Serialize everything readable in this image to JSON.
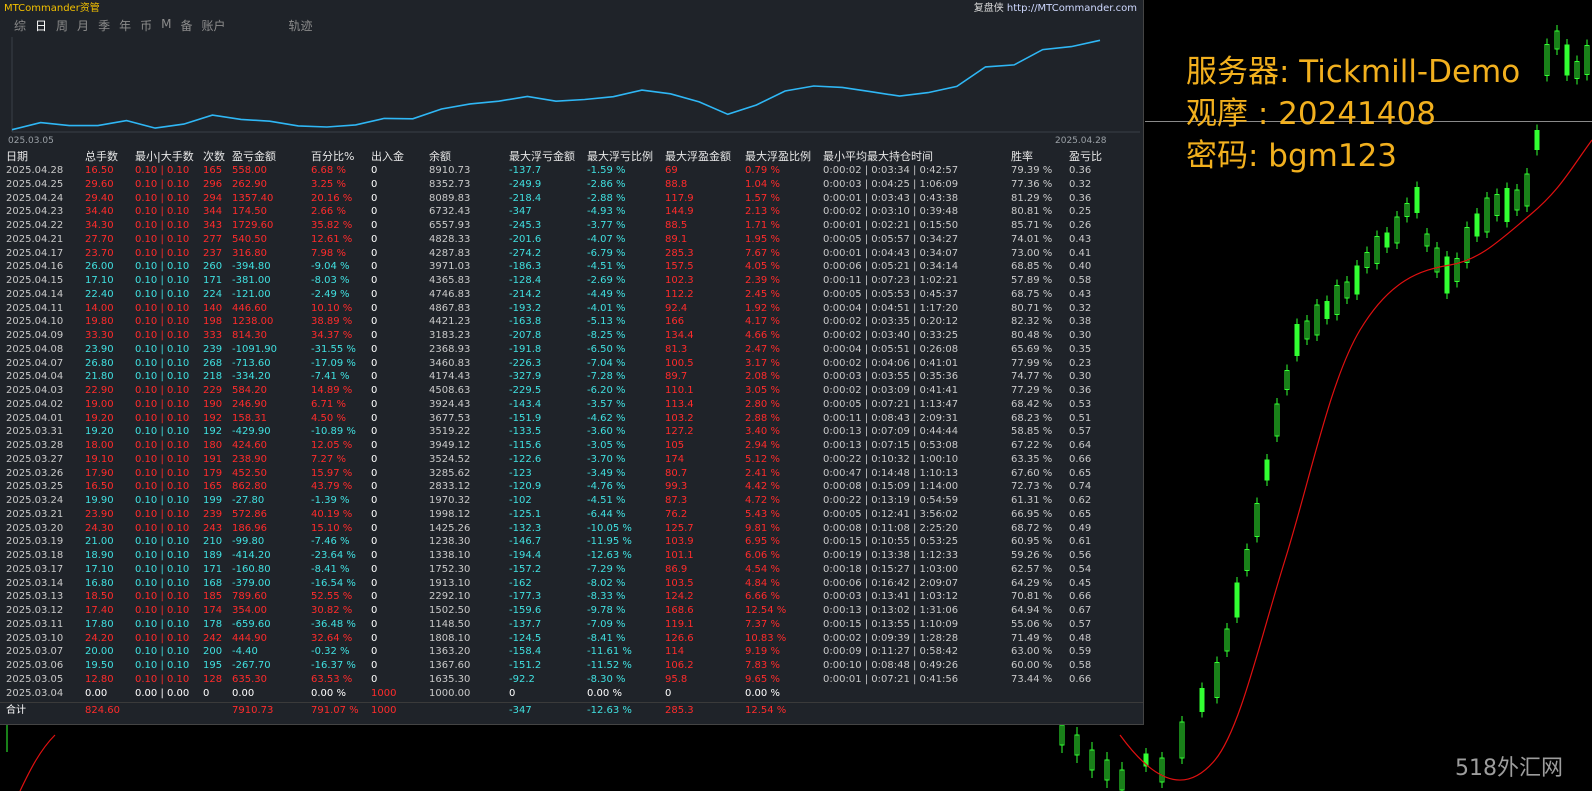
{
  "window": {
    "app_title": "MTCommander资管",
    "replay_label": "复盘侠",
    "replay_url": "http://MTCommander.com"
  },
  "tabs": [
    {
      "label": "综",
      "active": false
    },
    {
      "label": "日",
      "active": true
    },
    {
      "label": "周",
      "active": false
    },
    {
      "label": "月",
      "active": false
    },
    {
      "label": "季",
      "active": false
    },
    {
      "label": "年",
      "active": false
    },
    {
      "label": "币",
      "active": false
    },
    {
      "label": "M",
      "active": false
    },
    {
      "label": "备",
      "active": false
    },
    {
      "label": "账户",
      "active": false
    },
    {
      "label": "轨迹",
      "active": false
    }
  ],
  "equity_chart": {
    "start_label": "025.03.05",
    "end_label": "2025.04.28",
    "color": "#2fb7f5",
    "values": [
      1000,
      1635.3,
      1367.6,
      1363.2,
      1808.1,
      1148.5,
      1502.5,
      2292.1,
      1913.1,
      1752.3,
      1338.1,
      1238.3,
      1425.26,
      1998.12,
      1970.32,
      2833.12,
      3285.62,
      3524.52,
      3949.12,
      3519.22,
      3677.53,
      3924.43,
      4508.63,
      4174.43,
      3460.83,
      2368.93,
      3183.23,
      4421.23,
      4867.83,
      4746.83,
      4365.83,
      3971.03,
      4287.83,
      4828.33,
      6557.93,
      6732.43,
      8089.63,
      8352.73,
      8910.73
    ]
  },
  "table": {
    "headers": [
      "日期",
      "总手数",
      "最小|大手数",
      "次数",
      "盈亏金额",
      "百分比%",
      "出入金",
      "余额",
      "最大浮亏金额",
      "最大浮亏比例",
      "最大浮盈金额",
      "最大浮盈比例",
      "最小平均最大持仓时间",
      "胜率",
      "盈亏比"
    ],
    "rows": [
      [
        "2025.04.28",
        "16.50",
        "0.10 | 0.10",
        "165",
        "558.00",
        "6.68 %",
        "0",
        "8910.73",
        "-137.7",
        "-1.59 %",
        "69",
        "0.79 %",
        "0:00:02 | 0:03:34 | 0:42:57",
        "79.39 %",
        "0.36"
      ],
      [
        "2025.04.25",
        "29.60",
        "0.10 | 0.10",
        "296",
        "262.90",
        "3.25 %",
        "0",
        "8352.73",
        "-249.9",
        "-2.86 %",
        "88.8",
        "1.04 %",
        "0:00:03 | 0:04:25 | 1:06:09",
        "77.36 %",
        "0.32"
      ],
      [
        "2025.04.24",
        "29.40",
        "0.10 | 0.10",
        "294",
        "1357.40",
        "20.16 %",
        "0",
        "8089.83",
        "-218.4",
        "-2.88 %",
        "117.9",
        "1.57 %",
        "0:00:01 | 0:03:43 | 0:43:38",
        "81.29 %",
        "0.36"
      ],
      [
        "2025.04.23",
        "34.40",
        "0.10 | 0.10",
        "344",
        "174.50",
        "2.66 %",
        "0",
        "6732.43",
        "-347",
        "-4.93 %",
        "144.9",
        "2.13 %",
        "0:00:02 | 0:03:10 | 0:39:48",
        "80.81 %",
        "0.25"
      ],
      [
        "2025.04.22",
        "34.30",
        "0.10 | 0.10",
        "343",
        "1729.60",
        "35.82 %",
        "0",
        "6557.93",
        "-245.3",
        "-3.77 %",
        "88.5",
        "1.71 %",
        "0:00:01 | 0:02:21 | 0:15:50",
        "85.71 %",
        "0.26"
      ],
      [
        "2025.04.21",
        "27.70",
        "0.10 | 0.10",
        "277",
        "540.50",
        "12.61 %",
        "0",
        "4828.33",
        "-201.6",
        "-4.07 %",
        "89.1",
        "1.95 %",
        "0:00:05 | 0:05:57 | 0:34:27",
        "74.01 %",
        "0.43"
      ],
      [
        "2025.04.17",
        "23.70",
        "0.10 | 0.10",
        "237",
        "316.80",
        "7.98 %",
        "0",
        "4287.83",
        "-274.2",
        "-6.79 %",
        "285.3",
        "7.67 %",
        "0:00:01 | 0:04:43 | 0:34:07",
        "73.00 %",
        "0.41"
      ],
      [
        "2025.04.16",
        "26.00",
        "0.10 | 0.10",
        "260",
        "-394.80",
        "-9.04 %",
        "0",
        "3971.03",
        "-186.3",
        "-4.51 %",
        "157.5",
        "4.05 %",
        "0:00:06 | 0:05:21 | 0:34:14",
        "68.85 %",
        "0.40"
      ],
      [
        "2025.04.15",
        "17.10",
        "0.10 | 0.10",
        "171",
        "-381.00",
        "-8.03 %",
        "0",
        "4365.83",
        "-128.4",
        "-2.69 %",
        "102.3",
        "2.39 %",
        "0:00:11 | 0:07:23 | 1:02:21",
        "57.89 %",
        "0.58"
      ],
      [
        "2025.04.14",
        "22.40",
        "0.10 | 0.10",
        "224",
        "-121.00",
        "-2.49 %",
        "0",
        "4746.83",
        "-214.2",
        "-4.49 %",
        "112.2",
        "2.45 %",
        "0:00:05 | 0:05:53 | 0:45:37",
        "68.75 %",
        "0.43"
      ],
      [
        "2025.04.11",
        "14.00",
        "0.10 | 0.10",
        "140",
        "446.60",
        "10.10 %",
        "0",
        "4867.83",
        "-193.2",
        "-4.01 %",
        "92.4",
        "1.92 %",
        "0:00:04 | 0:04:51 | 1:17:20",
        "80.71 %",
        "0.32"
      ],
      [
        "2025.04.10",
        "19.80",
        "0.10 | 0.10",
        "198",
        "1238.00",
        "38.89 %",
        "0",
        "4421.23",
        "-163.8",
        "-5.13 %",
        "166",
        "4.17 %",
        "0:00:02 | 0:03:35 | 0:20:12",
        "82.32 %",
        "0.38"
      ],
      [
        "2025.04.09",
        "33.30",
        "0.10 | 0.10",
        "333",
        "814.30",
        "34.37 %",
        "0",
        "3183.23",
        "-207.8",
        "-8.25 %",
        "134.4",
        "4.66 %",
        "0:00:02 | 0:03:40 | 0:33:25",
        "80.48 %",
        "0.30"
      ],
      [
        "2025.04.08",
        "23.90",
        "0.10 | 0.10",
        "239",
        "-1091.90",
        "-31.55 %",
        "0",
        "2368.93",
        "-191.8",
        "-6.50 %",
        "81.3",
        "2.47 %",
        "0:00:04 | 0:05:51 | 0:26:08",
        "65.69 %",
        "0.35"
      ],
      [
        "2025.04.07",
        "26.80",
        "0.10 | 0.10",
        "268",
        "-713.60",
        "-17.09 %",
        "0",
        "3460.83",
        "-226.3",
        "-7.04 %",
        "100.5",
        "3.17 %",
        "0:00:02 | 0:04:06 | 0:41:01",
        "77.99 %",
        "0.23"
      ],
      [
        "2025.04.04",
        "21.80",
        "0.10 | 0.10",
        "218",
        "-334.20",
        "-7.41 %",
        "0",
        "4174.43",
        "-327.9",
        "-7.28 %",
        "89.7",
        "2.08 %",
        "0:00:03 | 0:03:55 | 0:35:36",
        "74.77 %",
        "0.30"
      ],
      [
        "2025.04.03",
        "22.90",
        "0.10 | 0.10",
        "229",
        "584.20",
        "14.89 %",
        "0",
        "4508.63",
        "-229.5",
        "-6.20 %",
        "110.1",
        "3.05 %",
        "0:00:02 | 0:03:09 | 0:41:41",
        "77.29 %",
        "0.36"
      ],
      [
        "2025.04.02",
        "19.00",
        "0.10 | 0.10",
        "190",
        "246.90",
        "6.71 %",
        "0",
        "3924.43",
        "-143.4",
        "-3.57 %",
        "113.4",
        "2.80 %",
        "0:00:05 | 0:07:21 | 1:13:47",
        "68.42 %",
        "0.53"
      ],
      [
        "2025.04.01",
        "19.20",
        "0.10 | 0.10",
        "192",
        "158.31",
        "4.50 %",
        "0",
        "3677.53",
        "-151.9",
        "-4.62 %",
        "103.2",
        "2.88 %",
        "0:00:11 | 0:08:43 | 2:09:31",
        "68.23 %",
        "0.51"
      ],
      [
        "2025.03.31",
        "19.20",
        "0.10 | 0.10",
        "192",
        "-429.90",
        "-10.89 %",
        "0",
        "3519.22",
        "-133.5",
        "-3.60 %",
        "127.2",
        "3.40 %",
        "0:00:13 | 0:07:09 | 0:44:44",
        "58.85 %",
        "0.57"
      ],
      [
        "2025.03.28",
        "18.00",
        "0.10 | 0.10",
        "180",
        "424.60",
        "12.05 %",
        "0",
        "3949.12",
        "-115.6",
        "-3.05 %",
        "105",
        "2.94 %",
        "0:00:13 | 0:07:15 | 0:53:08",
        "67.22 %",
        "0.64"
      ],
      [
        "2025.03.27",
        "19.10",
        "0.10 | 0.10",
        "191",
        "238.90",
        "7.27 %",
        "0",
        "3524.52",
        "-122.6",
        "-3.70 %",
        "174",
        "5.12 %",
        "0:00:22 | 0:10:32 | 1:00:10",
        "63.35 %",
        "0.66"
      ],
      [
        "2025.03.26",
        "17.90",
        "0.10 | 0.10",
        "179",
        "452.50",
        "15.97 %",
        "0",
        "3285.62",
        "-123",
        "-3.49 %",
        "80.7",
        "2.41 %",
        "0:00:47 | 0:14:48 | 1:10:13",
        "67.60 %",
        "0.65"
      ],
      [
        "2025.03.25",
        "16.50",
        "0.10 | 0.10",
        "165",
        "862.80",
        "43.79 %",
        "0",
        "2833.12",
        "-120.9",
        "-4.76 %",
        "99.3",
        "4.42 %",
        "0:00:08 | 0:15:09 | 1:14:00",
        "72.73 %",
        "0.74"
      ],
      [
        "2025.03.24",
        "19.90",
        "0.10 | 0.10",
        "199",
        "-27.80",
        "-1.39 %",
        "0",
        "1970.32",
        "-102",
        "-4.51 %",
        "87.3",
        "4.72 %",
        "0:00:22 | 0:13:19 | 0:54:59",
        "61.31 %",
        "0.62"
      ],
      [
        "2025.03.21",
        "23.90",
        "0.10 | 0.10",
        "239",
        "572.86",
        "40.19 %",
        "0",
        "1998.12",
        "-125.1",
        "-6.44 %",
        "76.2",
        "5.43 %",
        "0:00:05 | 0:12:41 | 3:56:02",
        "66.95 %",
        "0.65"
      ],
      [
        "2025.03.20",
        "24.30",
        "0.10 | 0.10",
        "243",
        "186.96",
        "15.10 %",
        "0",
        "1425.26",
        "-132.3",
        "-10.05 %",
        "125.7",
        "9.81 %",
        "0:00:08 | 0:11:08 | 2:25:20",
        "68.72 %",
        "0.49"
      ],
      [
        "2025.03.19",
        "21.00",
        "0.10 | 0.10",
        "210",
        "-99.80",
        "-7.46 %",
        "0",
        "1238.30",
        "-146.7",
        "-11.95 %",
        "103.9",
        "6.95 %",
        "0:00:15 | 0:10:55 | 0:53:25",
        "60.95 %",
        "0.61"
      ],
      [
        "2025.03.18",
        "18.90",
        "0.10 | 0.10",
        "189",
        "-414.20",
        "-23.64 %",
        "0",
        "1338.10",
        "-194.4",
        "-12.63 %",
        "101.1",
        "6.06 %",
        "0:00:19 | 0:13:38 | 1:12:33",
        "59.26 %",
        "0.56"
      ],
      [
        "2025.03.17",
        "17.10",
        "0.10 | 0.10",
        "171",
        "-160.80",
        "-8.41 %",
        "0",
        "1752.30",
        "-157.2",
        "-7.29 %",
        "86.9",
        "4.54 %",
        "0:00:18 | 0:15:27 | 1:03:00",
        "62.57 %",
        "0.54"
      ],
      [
        "2025.03.14",
        "16.80",
        "0.10 | 0.10",
        "168",
        "-379.00",
        "-16.54 %",
        "0",
        "1913.10",
        "-162",
        "-8.02 %",
        "103.5",
        "4.84 %",
        "0:00:06 | 0:16:42 | 2:09:07",
        "64.29 %",
        "0.45"
      ],
      [
        "2025.03.13",
        "18.50",
        "0.10 | 0.10",
        "185",
        "789.60",
        "52.55 %",
        "0",
        "2292.10",
        "-177.3",
        "-8.33 %",
        "124.2",
        "6.66 %",
        "0:00:03 | 0:13:41 | 1:03:12",
        "70.81 %",
        "0.66"
      ],
      [
        "2025.03.12",
        "17.40",
        "0.10 | 0.10",
        "174",
        "354.00",
        "30.82 %",
        "0",
        "1502.50",
        "-159.6",
        "-9.78 %",
        "168.6",
        "12.54 %",
        "0:00:13 | 0:13:02 | 1:31:06",
        "64.94 %",
        "0.67"
      ],
      [
        "2025.03.11",
        "17.80",
        "0.10 | 0.10",
        "178",
        "-659.60",
        "-36.48 %",
        "0",
        "1148.50",
        "-137.7",
        "-7.09 %",
        "119.1",
        "7.37 %",
        "0:00:15 | 0:13:55 | 1:10:09",
        "55.06 %",
        "0.57"
      ],
      [
        "2025.03.10",
        "24.20",
        "0.10 | 0.10",
        "242",
        "444.90",
        "32.64 %",
        "0",
        "1808.10",
        "-124.5",
        "-8.41 %",
        "126.6",
        "10.83 %",
        "0:00:02 | 0:09:39 | 1:28:28",
        "71.49 %",
        "0.48"
      ],
      [
        "2025.03.07",
        "20.00",
        "0.10 | 0.10",
        "200",
        "-4.40",
        "-0.32 %",
        "0",
        "1363.20",
        "-158.4",
        "-11.61 %",
        "114",
        "9.19 %",
        "0:00:09 | 0:11:27 | 0:58:42",
        "63.00 %",
        "0.59"
      ],
      [
        "2025.03.06",
        "19.50",
        "0.10 | 0.10",
        "195",
        "-267.70",
        "-16.37 %",
        "0",
        "1367.60",
        "-151.2",
        "-11.52 %",
        "106.2",
        "7.83 %",
        "0:00:10 | 0:08:48 | 0:49:26",
        "60.00 %",
        "0.58"
      ],
      [
        "2025.03.05",
        "12.80",
        "0.10 | 0.10",
        "128",
        "635.30",
        "63.53 %",
        "0",
        "1635.30",
        "-92.2",
        "-8.30 %",
        "95.8",
        "9.65 %",
        "0:00:01 | 0:07:21 | 0:41:56",
        "73.44 %",
        "0.66"
      ],
      [
        "2025.03.04",
        "0.00",
        "0.00 | 0.00",
        "0",
        "0.00",
        "0.00 %",
        "1000",
        "1000.00",
        "0",
        "0.00 %",
        "0",
        "0.00 %",
        "",
        "",
        ""
      ]
    ],
    "total": {
      "label": "合计",
      "lots": "824.60",
      "profit": "7910.73",
      "percent": "791.07 %",
      "deposit": "1000",
      "max_float_loss": "-347",
      "max_float_loss_pct": "-12.63 %",
      "max_float_profit": "285.3",
      "max_float_profit_pct": "12.54 %"
    }
  },
  "overlay": {
    "server_line": "服务器: Tickmill-Demo",
    "observe_line": "观摩 : 20241408",
    "password_line": "密码: bgm123",
    "color": "#f2b01e"
  },
  "watermark": "518外汇网",
  "colors": {
    "profit": "#ff2b2b",
    "loss": "#40e0e0",
    "bull_candle": "#32ff32",
    "ma_line": "#e01010"
  }
}
